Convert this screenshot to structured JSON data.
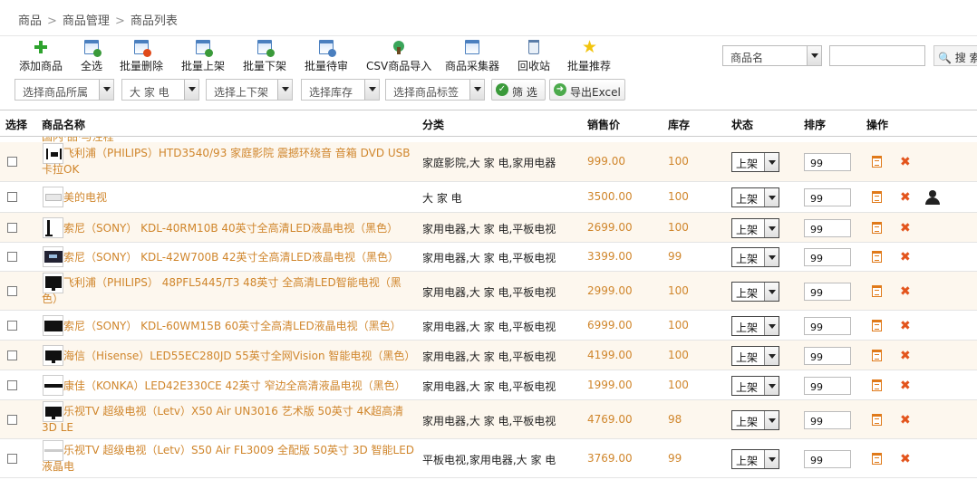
{
  "breadcrumb": [
    "商品",
    "商品管理",
    "商品列表"
  ],
  "toolbar": {
    "add": "添加商品",
    "select_all": "全选",
    "batch_delete": "批量删除",
    "batch_online": "批量上架",
    "batch_offline": "批量下架",
    "batch_pending": "批量待审",
    "csv_import": "CSV商品导入",
    "collector": "商品采集器",
    "recycle": "回收站",
    "batch_recommend": "批量推荐"
  },
  "search": {
    "field": "商品名",
    "value": "",
    "button": "搜 索"
  },
  "filters": {
    "owner": "选择商品所属",
    "category": "大 家 电",
    "shelf": "选择上下架",
    "stock": "选择库存",
    "tag": "选择商品标签",
    "filter_button": "筛 选",
    "export_button": "导出Excel"
  },
  "columns": [
    "选择",
    "商品名称",
    "分类",
    "销售价",
    "库存",
    "状态",
    "排序",
    "操作"
  ],
  "cut_text": "国内·品·与注程",
  "products": [
    {
      "name": "飞利浦（PHILIPS）HTD3540/93 家庭影院 震撼环绕音 音箱 DVD USB 卡拉OK",
      "category": "家庭影院,大 家 电,家用电器",
      "price": "999.00",
      "stock": "100",
      "status": "上架",
      "sort": "99"
    },
    {
      "name": "美的电视",
      "category": "大 家 电",
      "price": "3500.00",
      "stock": "100",
      "status": "上架",
      "sort": "99"
    },
    {
      "name": "索尼（SONY） KDL-40RM10B 40英寸全高清LED液晶电视（黑色）",
      "category": "家用电器,大 家 电,平板电视",
      "price": "2699.00",
      "stock": "100",
      "status": "上架",
      "sort": "99"
    },
    {
      "name": "索尼（SONY） KDL-42W700B 42英寸全高清LED液晶电视（黑色）",
      "category": "家用电器,大 家 电,平板电视",
      "price": "3399.00",
      "stock": "99",
      "status": "上架",
      "sort": "99"
    },
    {
      "name": "飞利浦（PHILIPS） 48PFL5445/T3 48英寸 全高清LED智能电视（黑色）",
      "category": "家用电器,大 家 电,平板电视",
      "price": "2999.00",
      "stock": "100",
      "status": "上架",
      "sort": "99"
    },
    {
      "name": "索尼（SONY） KDL-60WM15B 60英寸全高清LED液晶电视（黑色）",
      "category": "家用电器,大 家 电,平板电视",
      "price": "6999.00",
      "stock": "100",
      "status": "上架",
      "sort": "99"
    },
    {
      "name": "海信（Hisense）LED55EC280JD 55英寸全网Vision 智能电视（黑色）",
      "category": "家用电器,大 家 电,平板电视",
      "price": "4199.00",
      "stock": "100",
      "status": "上架",
      "sort": "99"
    },
    {
      "name": "康佳（KONKA）LED42E330CE 42英寸 窄边全高清液晶电视（黑色）",
      "category": "家用电器,大 家 电,平板电视",
      "price": "1999.00",
      "stock": "100",
      "status": "上架",
      "sort": "99"
    },
    {
      "name": "乐视TV 超级电视（Letv）X50 Air UN3016 艺术版 50英寸 4K超高清 3D LE",
      "category": "家用电器,大 家 电,平板电视",
      "price": "4769.00",
      "stock": "98",
      "status": "上架",
      "sort": "99"
    },
    {
      "name": "乐视TV 超级电视（Letv）S50 Air FL3009 全配版 50英寸 3D 智能LED液晶电",
      "category": "平板电视,家用电器,大 家 电",
      "price": "3769.00",
      "stock": "99",
      "status": "上架",
      "sort": "99"
    }
  ]
}
